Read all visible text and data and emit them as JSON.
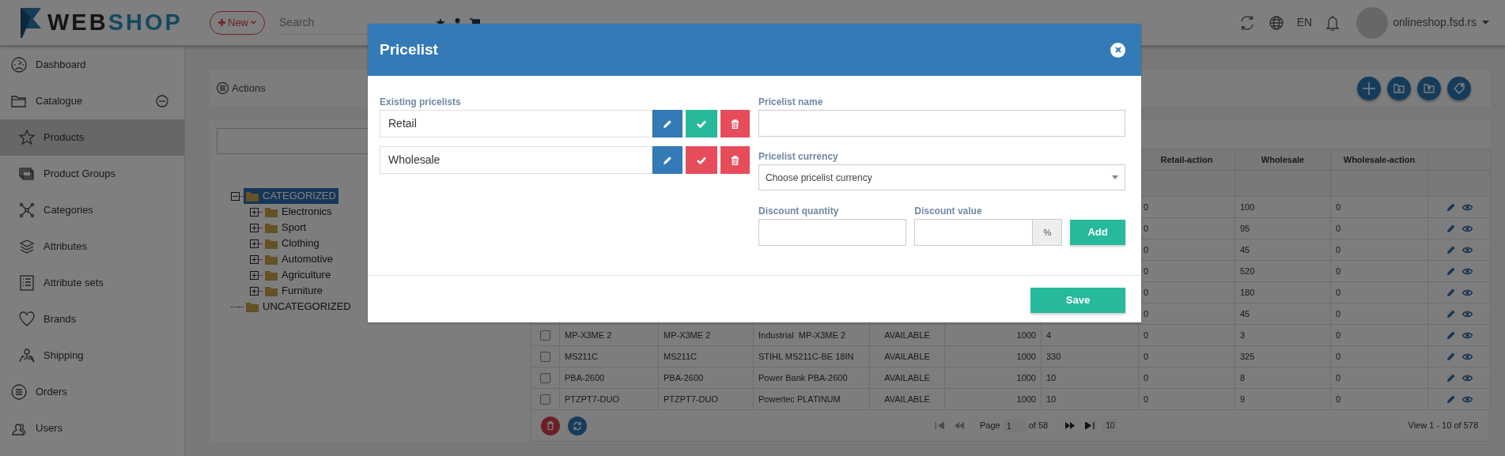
{
  "header": {
    "logo": {
      "part_1": "WEB",
      "part_2": "SHOP"
    },
    "new_button": "New",
    "search": {
      "placeholder": "Search"
    },
    "language": "EN",
    "account": "onlineshop.fsd.rs"
  },
  "sidebar": {
    "items": [
      {
        "label": "Dashboard",
        "selected": false
      },
      {
        "label": "Catalogue",
        "selected": false,
        "expanded": true,
        "children": [
          {
            "label": "Products",
            "selected": true
          },
          {
            "label": "Product Groups",
            "selected": false
          },
          {
            "label": "Categories",
            "selected": false
          },
          {
            "label": "Attributes",
            "selected": false
          },
          {
            "label": "Attribute sets",
            "selected": false
          },
          {
            "label": "Brands",
            "selected": false
          },
          {
            "label": "Shipping",
            "selected": false
          }
        ]
      },
      {
        "label": "Orders",
        "selected": false
      },
      {
        "label": "Users",
        "selected": false
      }
    ]
  },
  "actions_bar": {
    "label": "Actions"
  },
  "category_tree": [
    {
      "label": "CATEGORIZED",
      "selected": true,
      "expanded": true,
      "children": [
        {
          "label": "Electronics",
          "selected": false,
          "expanded": false
        },
        {
          "label": "Sport",
          "selected": false,
          "expanded": false
        },
        {
          "label": "Clothing",
          "selected": false,
          "expanded": false
        },
        {
          "label": "Automotive",
          "selected": false,
          "expanded": false
        },
        {
          "label": "Agriculture",
          "selected": false,
          "expanded": false
        },
        {
          "label": "Furniture",
          "selected": false,
          "expanded": false
        }
      ]
    },
    {
      "label": "UNCATEGORIZED",
      "selected": false
    }
  ],
  "table": {
    "columns": [
      "Retail-action",
      "Wholesale",
      "Wholesale-action"
    ],
    "rows": [
      {
        "right_cells": [
          "0",
          "100",
          "0"
        ]
      },
      {
        "right_cells": [
          "0",
          "95",
          "0"
        ]
      },
      {
        "right_cells": [
          "0",
          "45",
          "0"
        ]
      },
      {
        "right_cells": [
          "0",
          "520",
          "0"
        ]
      },
      {
        "right_cells": [
          "0",
          "180",
          "0"
        ]
      },
      {
        "right_cells": [
          "0",
          "45",
          "0"
        ]
      },
      {
        "checked": false,
        "left_cells": [
          "MP-X3ME 2",
          "MP-X3ME 2",
          "Industrial  MP-X3ME 2",
          "AVAILABLE",
          "1000",
          "4"
        ],
        "right_cells": [
          "0",
          "3",
          "0"
        ]
      },
      {
        "checked": false,
        "left_cells": [
          "MS211C",
          "MS211C",
          "STIHL MS211C-BE 18IN",
          "AVAILABLE",
          "1000",
          "330"
        ],
        "right_cells": [
          "0",
          "325",
          "0"
        ]
      },
      {
        "checked": false,
        "left_cells": [
          "PBA-2600",
          "PBA-2600",
          "Power Bank PBA-2600",
          "AVAILABLE",
          "1000",
          "10"
        ],
        "right_cells": [
          "0",
          "8",
          "0"
        ]
      },
      {
        "checked": false,
        "left_cells": [
          "PTZPT7-DUO",
          "PTZPT7-DUO",
          "Powertec PLATINUM",
          "AVAILABLE",
          "1000",
          "10"
        ],
        "right_cells": [
          "0",
          "9",
          "0"
        ]
      }
    ]
  },
  "pagination": {
    "page_label": "Page",
    "page": "1",
    "of_pages": "of 58",
    "page_size": "10",
    "summary": "View 1 - 10 of 578"
  },
  "modal": {
    "title": "Pricelist",
    "existing_label": "Existing pricelists",
    "pricelists": [
      {
        "name": "Retail",
        "active": true
      },
      {
        "name": "Wholesale",
        "active": false
      }
    ],
    "name_label": "Pricelist name",
    "currency_label": "Pricelist currency",
    "currency": {
      "placeholder": "Choose pricelist currency"
    },
    "discount_quantity_label": "Discount quantity",
    "discount_value_label": "Discount value",
    "discount_unit": "%",
    "add_button": "Add",
    "save_button": "Save"
  }
}
